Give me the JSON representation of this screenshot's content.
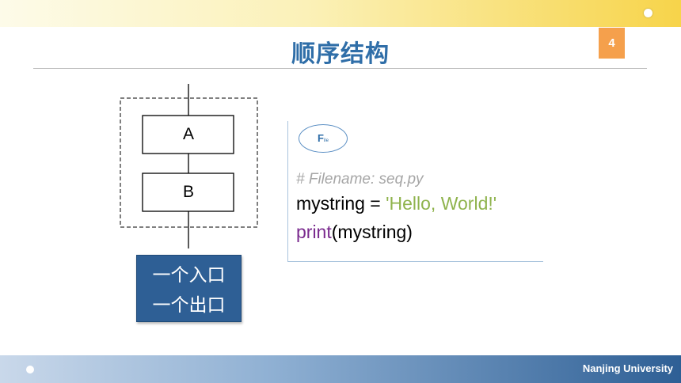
{
  "slide": {
    "title": "顺序结构",
    "page_number": "4"
  },
  "flowchart": {
    "box_a": "A",
    "box_b": "B",
    "note_line1": "一个入口",
    "note_line2": "一个出口"
  },
  "code": {
    "file_icon_label": "F",
    "file_icon_sub": "ile",
    "comment": "# Filename: seq.py",
    "line2_var": "mystring = ",
    "line2_string": "'Hello, World!'",
    "line3_func": "print",
    "line3_args": "(mystring)"
  },
  "footer": {
    "university": "Nanjing University"
  },
  "colors": {
    "title": "#2f6ea8",
    "page_badge": "#f5a04c",
    "note_box": "#2e5f95",
    "string": "#8fb34d",
    "keyword": "#7a2a8e",
    "comment": "#a6a6a6"
  }
}
